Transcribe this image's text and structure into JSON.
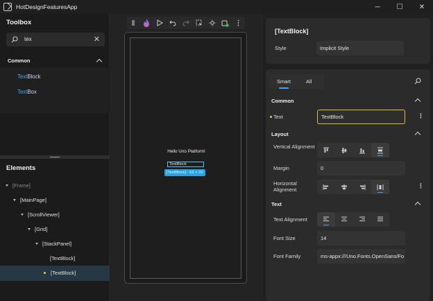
{
  "window": {
    "title": "HotDesignFeaturesApp",
    "minimize": "─",
    "maximize": "☐",
    "close": "✕"
  },
  "toolbox": {
    "title": "Toolbox",
    "search": {
      "value": "tex",
      "clear": "✕"
    },
    "section": "Common",
    "items": [
      {
        "match": "Text",
        "rest": "Block"
      },
      {
        "match": "Text",
        "rest": "Box"
      }
    ]
  },
  "elements": {
    "title": "Elements",
    "tree": [
      {
        "label": "[Frame]"
      },
      {
        "label": "[MainPage]"
      },
      {
        "label": "[ScrollViewer]"
      },
      {
        "label": "[Grid]"
      },
      {
        "label": "[StackPanel]"
      },
      {
        "label": "[TextBlock]"
      },
      {
        "label": "[TextBlock]"
      }
    ]
  },
  "canvas": {
    "hello": "Hello Uno Platform!",
    "textblock": "TextBlock",
    "badge": "[TextBlock] - 63 × 20"
  },
  "properties": {
    "title": "[TextBlock]",
    "style_label": "Style",
    "style_value": "Implicit Style",
    "tabs": [
      "Smart",
      "All"
    ],
    "groups": {
      "common": "Common",
      "layout": "Layout",
      "text": "Text"
    },
    "text_label": "Text",
    "text_value": "TextBlock",
    "vertical_alignment_label": "Vertical Alignment",
    "margin_label": "Margin",
    "margin_value": "0",
    "horizontal_alignment_label": "Horizontal Alignment",
    "text_alignment_label": "Text Alignment",
    "font_size_label": "Font Size",
    "font_size_value": "14",
    "font_family_label": "Font Family",
    "font_family_value": "ms-appx:///Uno.Fonts.OpenSans/Fo"
  },
  "colors": {
    "accent": "#3fa4ff",
    "selected_dot": "#e6d23a",
    "badge": "#2aa3e0"
  }
}
